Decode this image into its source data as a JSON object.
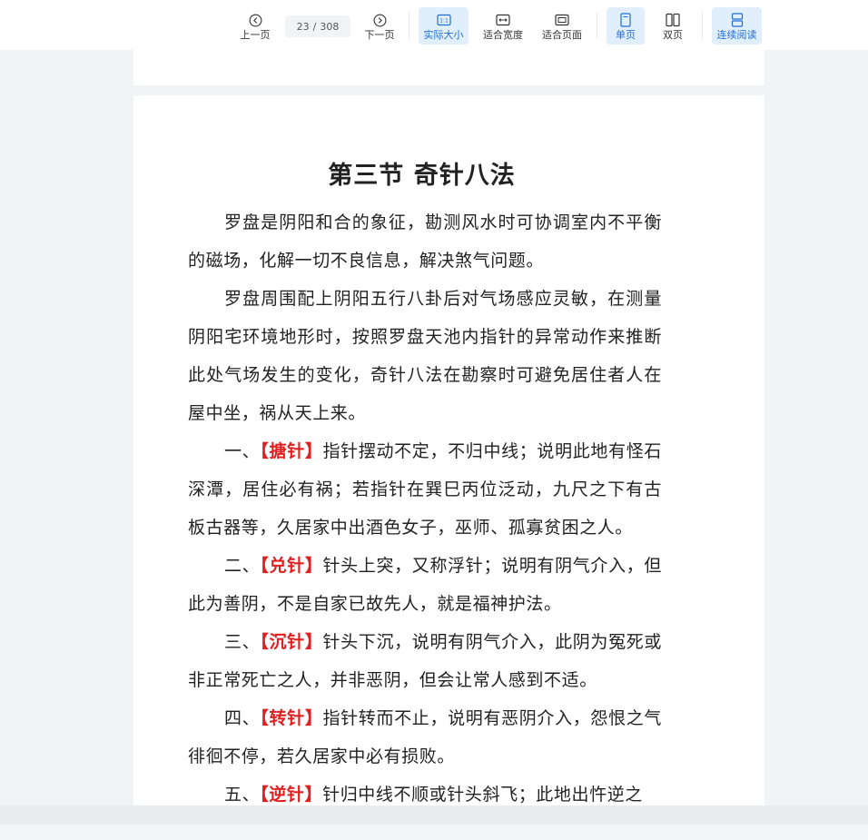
{
  "toolbar": {
    "prev_page": "上一页",
    "page_current": "23",
    "page_separator": "/",
    "page_total": "308",
    "next_page": "下一页",
    "actual_size": "实际大小",
    "fit_width": "适合宽度",
    "fit_page": "适合页面",
    "single_page": "单页",
    "double_page": "双页",
    "continuous": "连续阅读"
  },
  "document": {
    "title": "第三节  奇针八法",
    "paragraphs": [
      {
        "prefix": "",
        "tag": "",
        "text": "罗盘是阴阳和合的象征，勘测风水时可协调室内不平衡的磁场，化解一切不良信息，解决煞气问题。"
      },
      {
        "prefix": "",
        "tag": "",
        "text": "罗盘周围配上阴阳五行八卦后对气场感应灵敏，在测量阴阳宅环境地形时，按照罗盘天池内指针的异常动作来推断此处气场发生的变化，奇针八法在勘察时可避免居住者人在屋中坐，祸从天上来。"
      },
      {
        "prefix": "一、",
        "tag": "【搪针】",
        "text": "指针摆动不定，不归中线；说明此地有怪石深潭，居住必有祸；若指针在巽巳丙位泛动，九尺之下有古板古器等，久居家中出酒色女子，巫师、孤寡贫困之人。"
      },
      {
        "prefix": "二、",
        "tag": "【兑针】",
        "text": "针头上突，又称浮针；说明有阴气介入，但此为善阴，不是自家已故先人，就是福神护法。"
      },
      {
        "prefix": "三、",
        "tag": "【沉针】",
        "text": "针头下沉，说明有阴气介入，此阴为冤死或非正常死亡之人，并非恶阴，但会让常人感到不适。"
      },
      {
        "prefix": "四、",
        "tag": "【转针】",
        "text": "指针转而不止，说明有恶阴介入，怨恨之气徘徊不停，若久居家中必有损败。"
      },
      {
        "prefix": "五、",
        "tag": "【逆针】",
        "text": "针归中线不顺或针头斜飞；此地出忤逆之"
      }
    ]
  },
  "colors": {
    "accent": "#1f6fd6",
    "active_bg": "#e1eefc",
    "tag_red": "#e02020"
  }
}
